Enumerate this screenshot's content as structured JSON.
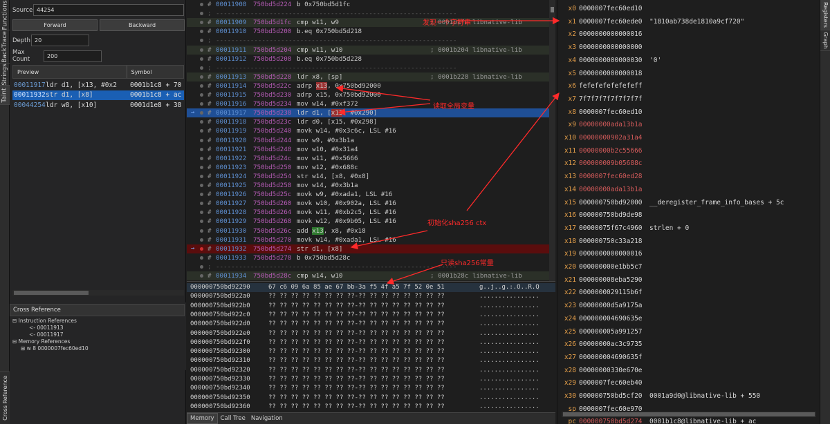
{
  "left_tabs": [
    "Functions",
    "BackTrace",
    "Strings",
    "Taint"
  ],
  "left_bottom_tab": "Cross Reference",
  "source": {
    "label": "Source",
    "value": "44254"
  },
  "buttons": {
    "forward": "Forward",
    "backward": "Backward"
  },
  "depth": {
    "label": "Depth",
    "value": "20"
  },
  "max_count": {
    "label": "Max Count",
    "value": "200"
  },
  "table": {
    "headers": [
      "Preview",
      "Symbol"
    ],
    "rows": [
      {
        "addr": "00011917",
        "ins": "ldr d1, [x13, #0x2",
        "sym": "0001b1c8 + 70",
        "selected": false
      },
      {
        "addr": "00011932",
        "ins": "str d1, [x8]",
        "sym": "0001b1c8 + ac",
        "selected": true
      },
      {
        "addr": "00044254",
        "ins": "ldr w8, [x10]",
        "sym": "0001d1e8 + 38",
        "selected": false
      }
    ]
  },
  "xref": {
    "title": "Cross Reference",
    "instruction_refs": "Instruction References",
    "iref_items": [
      "<- 00011913",
      "<- 00011917"
    ],
    "memory_refs": "Memory References",
    "mref_items": [
      "w 8 0000007fec60ed10"
    ]
  },
  "disasm": [
    {
      "t": "code",
      "m": "#",
      "a": "00011908",
      "v": "750bd5d224",
      "i": "b 0x750bd5d1fc",
      "c": ""
    },
    {
      "t": "sep",
      "m": ";"
    },
    {
      "t": "code",
      "m": "#",
      "a": "00011909",
      "v": "750bd5d1fc",
      "i": "cmp w11, w9",
      "c": "; 0001b1fc libnative-lib"
    },
    {
      "t": "code",
      "m": "#",
      "a": "00011910",
      "v": "750bd5d200",
      "i": "b.eq 0x750bd5d218",
      "c": ""
    },
    {
      "t": "sep",
      "m": ";"
    },
    {
      "t": "code",
      "m": "#",
      "a": "00011911",
      "v": "750bd5d204",
      "i": "cmp w11, w10",
      "c": "; 0001b204 libnative-lib"
    },
    {
      "t": "code",
      "m": "#",
      "a": "00011912",
      "v": "750bd5d208",
      "i": "b.eq 0x750bd5d228",
      "c": ""
    },
    {
      "t": "sep",
      "m": ";"
    },
    {
      "t": "code",
      "m": "#",
      "a": "00011913",
      "v": "750bd5d228",
      "i": "ldr x8, [sp]",
      "c": "; 0001b228 libnative-lib"
    },
    {
      "t": "code",
      "m": "#",
      "a": "00011914",
      "v": "750bd5d22c",
      "i": "adrp x13, 0x750bd92000",
      "c": ""
    },
    {
      "t": "code",
      "m": "#",
      "a": "00011915",
      "v": "750bd5d230",
      "i": "adrp x15, 0x750bd92000",
      "c": ""
    },
    {
      "t": "code",
      "m": "#",
      "a": "00011916",
      "v": "750bd5d234",
      "i": "mov w14, #0xf372",
      "c": ""
    },
    {
      "t": "code",
      "m": "#",
      "a": "00011917",
      "v": "750bd5d238",
      "i": "ldr d1, [x13, #0x290]",
      "c": "",
      "hl": "blue"
    },
    {
      "t": "code",
      "m": "#",
      "a": "00011918",
      "v": "750bd5d23c",
      "i": "ldr d0, [x15, #0x298]",
      "c": ""
    },
    {
      "t": "code",
      "m": "#",
      "a": "00011919",
      "v": "750bd5d240",
      "i": "movk w14, #0x3c6c, LSL #16",
      "c": ""
    },
    {
      "t": "code",
      "m": "#",
      "a": "00011920",
      "v": "750bd5d244",
      "i": "mov w9, #0x3b1a",
      "c": ""
    },
    {
      "t": "code",
      "m": "#",
      "a": "00011921",
      "v": "750bd5d248",
      "i": "mov w10, #0x31a4",
      "c": ""
    },
    {
      "t": "code",
      "m": "#",
      "a": "00011922",
      "v": "750bd5d24c",
      "i": "mov w11, #0x5666",
      "c": ""
    },
    {
      "t": "code",
      "m": "#",
      "a": "00011923",
      "v": "750bd5d250",
      "i": "mov w12, #0x688c",
      "c": ""
    },
    {
      "t": "code",
      "m": "#",
      "a": "00011924",
      "v": "750bd5d254",
      "i": "str w14, [x8, #0x8]",
      "c": ""
    },
    {
      "t": "code",
      "m": "#",
      "a": "00011925",
      "v": "750bd5d258",
      "i": "mov w14, #0x3b1a",
      "c": ""
    },
    {
      "t": "code",
      "m": "#",
      "a": "00011926",
      "v": "750bd5d25c",
      "i": "movk w9, #0xada1, LSL #16",
      "c": ""
    },
    {
      "t": "code",
      "m": "#",
      "a": "00011927",
      "v": "750bd5d260",
      "i": "movk w10, #0x902a, LSL #16",
      "c": ""
    },
    {
      "t": "code",
      "m": "#",
      "a": "00011928",
      "v": "750bd5d264",
      "i": "movk w11, #0xb2c5, LSL #16",
      "c": ""
    },
    {
      "t": "code",
      "m": "#",
      "a": "00011929",
      "v": "750bd5d268",
      "i": "movk w12, #0x9b05, LSL #16",
      "c": ""
    },
    {
      "t": "code",
      "m": "#",
      "a": "00011930",
      "v": "750bd5d26c",
      "i": "add x13, x8, #0x18",
      "c": ""
    },
    {
      "t": "code",
      "m": "#",
      "a": "00011931",
      "v": "750bd5d270",
      "i": "movk w14, #0xada1, LSL #16",
      "c": ""
    },
    {
      "t": "code",
      "m": "#",
      "a": "00011932",
      "v": "750bd5d274",
      "i": "str d1, [x8]",
      "c": "",
      "hl": "red"
    },
    {
      "t": "code",
      "m": "#",
      "a": "00011933",
      "v": "750bd5d278",
      "i": "b 0x750bd5d28c",
      "c": ""
    },
    {
      "t": "sep",
      "m": ";"
    },
    {
      "t": "code",
      "m": "#",
      "a": "00011934",
      "v": "750bd5d28c",
      "i": "cmp w14, w10",
      "c": "; 0001b28c libnative-lib"
    }
  ],
  "hex": {
    "first": {
      "addr": "000000750bd92290",
      "bytes": "67 c6 09 6a 85 ae 67 bb-3a f5 4f a5 7f 52 0e 51",
      "ascii": "g..j..g.:.O..R.Q"
    },
    "unknown_bytes": "?? ?? ?? ?? ?? ?? ?? ??-?? ?? ?? ?? ?? ?? ?? ??",
    "unknown_ascii": "................",
    "addrs": [
      "000000750bd922a0",
      "000000750bd922b0",
      "000000750bd922c0",
      "000000750bd922d0",
      "000000750bd922e0",
      "000000750bd922f0",
      "000000750bd92300",
      "000000750bd92310",
      "000000750bd92320",
      "000000750bd92330",
      "000000750bd92340",
      "000000750bd92350",
      "000000750bd92360"
    ]
  },
  "bottom_tabs": [
    "Memory",
    "Call Tree",
    "Navigation"
  ],
  "registers": [
    {
      "n": "x0",
      "v": "0000007fec60ed10",
      "x": "",
      "chg": false
    },
    {
      "n": "x1",
      "v": "0000007fec60ede0",
      "x": "\"1810ab738de1810a9cf720\"",
      "chg": false
    },
    {
      "n": "x2",
      "v": "0000000000000016",
      "x": "",
      "chg": false
    },
    {
      "n": "x3",
      "v": "0000000000000000",
      "x": "",
      "chg": false
    },
    {
      "n": "x4",
      "v": "0000000000000030",
      "x": "'0'",
      "chg": false
    },
    {
      "n": "x5",
      "v": "0000000000000018",
      "x": "",
      "chg": false
    },
    {
      "n": "x6",
      "v": "fefefefefefefeff",
      "x": "",
      "chg": false
    },
    {
      "n": "x7",
      "v": "7f7f7f7f7f7f7f7f",
      "x": "",
      "chg": false
    },
    {
      "n": "x8",
      "v": "0000007fec60ed10",
      "x": "",
      "chg": false
    },
    {
      "n": "x9",
      "v": "00000000ada13b1a",
      "x": "",
      "chg": true
    },
    {
      "n": "x10",
      "v": "00000000902a31a4",
      "x": "",
      "chg": true
    },
    {
      "n": "x11",
      "v": "00000000b2c55666",
      "x": "",
      "chg": true
    },
    {
      "n": "x12",
      "v": "000000009b05688c",
      "x": "",
      "chg": true
    },
    {
      "n": "x13",
      "v": "0000007fec60ed28",
      "x": "",
      "chg": true
    },
    {
      "n": "x14",
      "v": "00000000ada13b1a",
      "x": "",
      "chg": true
    },
    {
      "n": "x15",
      "v": "000000750bd92000",
      "x": "__deregister_frame_info_bases + 5c",
      "chg": false
    },
    {
      "n": "x16",
      "v": "000000750bd9de98",
      "x": "",
      "chg": false
    },
    {
      "n": "x17",
      "v": "00000075f67c4960",
      "x": "strlen + 0",
      "chg": false
    },
    {
      "n": "x18",
      "v": "000000750c33a218",
      "x": "",
      "chg": false
    },
    {
      "n": "x19",
      "v": "0000000000000016",
      "x": "",
      "chg": false
    },
    {
      "n": "x20",
      "v": "000000000e1bb5c7",
      "x": "",
      "chg": false
    },
    {
      "n": "x21",
      "v": "000000008eba5290",
      "x": "",
      "chg": false
    },
    {
      "n": "x22",
      "v": "0000000029115b6f",
      "x": "",
      "chg": false
    },
    {
      "n": "x23",
      "v": "00000000d5a9175a",
      "x": "",
      "chg": false
    },
    {
      "n": "x24",
      "v": "000000004690635e",
      "x": "",
      "chg": false
    },
    {
      "n": "x25",
      "v": "000000005a991257",
      "x": "",
      "chg": false
    },
    {
      "n": "x26",
      "v": "00000000ac3c9735",
      "x": "",
      "chg": false
    },
    {
      "n": "x27",
      "v": "000000004690635f",
      "x": "",
      "chg": false
    },
    {
      "n": "x28",
      "v": "00000000330e670e",
      "x": "",
      "chg": false
    },
    {
      "n": "x29",
      "v": "0000007fec60eb40",
      "x": "",
      "chg": false
    },
    {
      "n": "x30",
      "v": "000000750bd5cf20",
      "x": "0001a9d0@libnative-lib + 550",
      "chg": false
    },
    {
      "n": "sp",
      "v": "0000007fec60e970",
      "x": "",
      "chg": false
    },
    {
      "n": "pc",
      "v": "000000750bd5d274",
      "x": "0001b1c8@libnative-lib + ac",
      "chg": true
    }
  ],
  "right_tabs": [
    "Registers",
    "Graph"
  ],
  "annotations": {
    "a1": "发现一个字符串",
    "a2": "读取全局变量",
    "a3": "初始化sha256 ctx",
    "a4": "只读sha256常量"
  },
  "colors": {
    "accent_blue": "#1f4f96",
    "highlight_red": "#5a0d0d",
    "annotation": "#ff2a2a",
    "register_name": "#e6a04a"
  }
}
